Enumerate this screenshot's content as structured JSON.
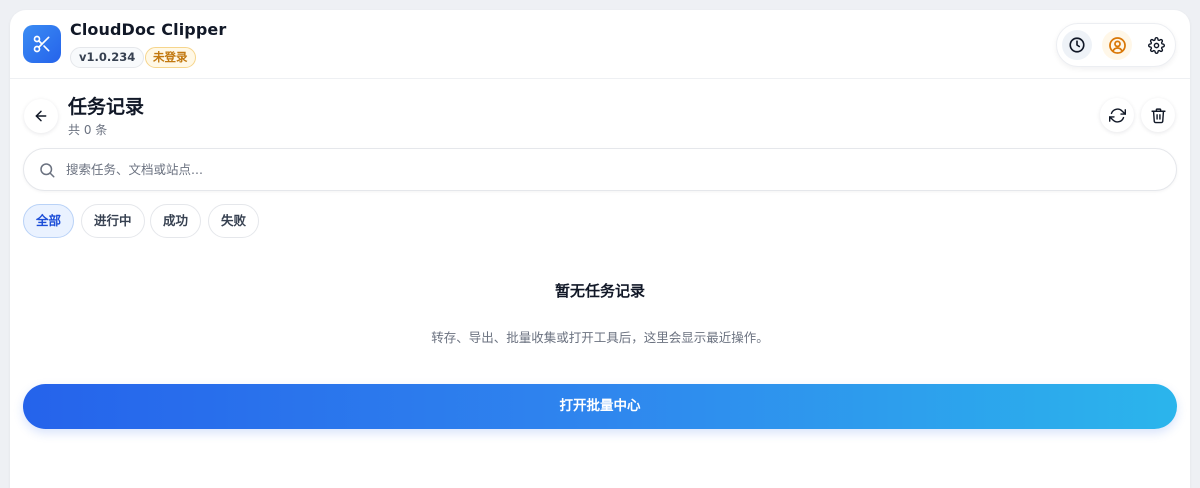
{
  "app": {
    "title": "CloudDoc Clipper",
    "version": "v1.0.234",
    "login_status": "未登录",
    "logo_icon": "scissors-icon"
  },
  "header_actions": {
    "history_icon": "clock-icon",
    "user_icon": "user-circle-icon",
    "settings_icon": "gear-icon"
  },
  "page": {
    "title": "任务记录",
    "count": "共 0 条",
    "back_icon": "arrow-left-icon",
    "refresh_icon": "refresh-icon",
    "delete_icon": "trash-icon"
  },
  "search": {
    "placeholder": "搜索任务、文档或站点...",
    "value": ""
  },
  "filters": [
    {
      "label": "全部",
      "active": true
    },
    {
      "label": "进行中",
      "active": false
    },
    {
      "label": "成功",
      "active": false
    },
    {
      "label": "失败",
      "active": false
    }
  ],
  "empty_state": {
    "title": "暂无任务记录",
    "description": "转存、导出、批量收集或打开工具后，这里会显示最近操作。",
    "button_label": "打开批量中心"
  },
  "colors": {
    "accent": "#2563eb",
    "accent_end": "#2bb5ec",
    "warning": "#c2780f"
  }
}
